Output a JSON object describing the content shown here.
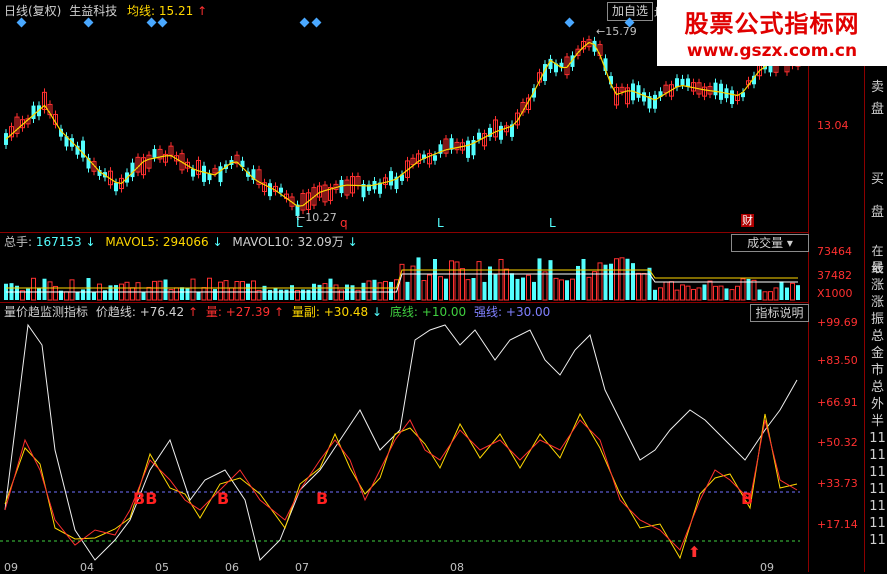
{
  "price_panel": {
    "header": {
      "period": "日线(复权)",
      "stock": "生益科技",
      "ma_label": "均线:",
      "ma_value": "15.21"
    },
    "high_label": "15.79",
    "low_label": "10.27",
    "right_axis": "13.04",
    "markers": [
      "L",
      "L",
      "L"
    ],
    "q_marker": "q",
    "cai_marker": "财",
    "buttons": {
      "add_watch": "加自选",
      "partial": "均"
    },
    "side_tabs": [
      "卖",
      "盘",
      "买",
      "盘"
    ]
  },
  "volume_panel": {
    "total_label": "总手:",
    "total_value": "167153",
    "mavol5_label": "MAVOL5:",
    "mavol5_value": "294066",
    "mavol10_label": "MAVOL10:",
    "mavol10_value": "32.09万",
    "axis": [
      "73464",
      "37482",
      "X1000"
    ],
    "button": "成交量"
  },
  "indicator_panel": {
    "name": "量价趋监测指标",
    "trend_label": "价趋线:",
    "trend_value": "+76.42",
    "vol_label": "量:",
    "vol_value": "+27.39",
    "vice_label": "量副:",
    "vice_value": "+30.48",
    "bottom_label": "底线:",
    "bottom_value": "+10.00",
    "strong_label": "强线:",
    "strong_value": "+30.00",
    "axis": [
      "+99.69",
      "+83.50",
      "+66.91",
      "+50.32",
      "+33.73",
      "+17.14"
    ],
    "b_markers": [
      "BB",
      "B",
      "B",
      "B"
    ],
    "button": "指标说明"
  },
  "date_axis": [
    "09",
    "04",
    "05",
    "06",
    "07",
    "08",
    "09"
  ],
  "side_right": [
    "在线",
    "最",
    "涨",
    "涨",
    "振",
    "总",
    "金",
    "市",
    "总",
    "外",
    "半",
    "11",
    "11",
    "11",
    "11",
    "11",
    "11",
    "11"
  ],
  "watermark": {
    "title": "股票公式指标网",
    "url": "www.gszx.com.cn"
  },
  "colors": {
    "up": "#ff3030",
    "down": "#54ffff",
    "bg": "#000000",
    "ma": "#ffd700",
    "border": "#8b0000"
  }
}
